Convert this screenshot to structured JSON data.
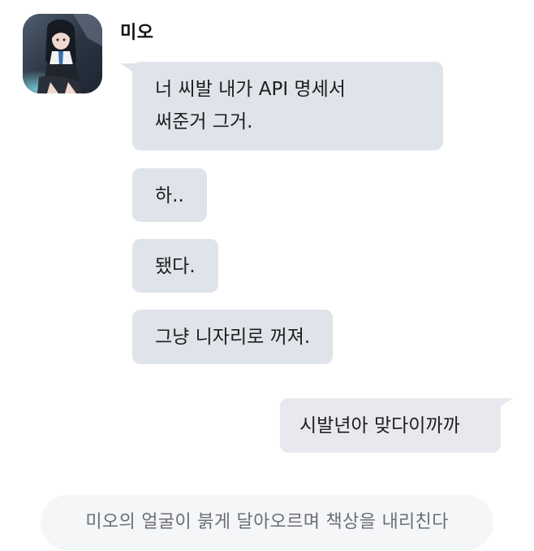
{
  "chat": {
    "sender_name": "미오",
    "messages_in": [
      "너 씨발 내가 API 명세서\n써준거 그거.",
      "하..",
      "됐다.",
      "그냥 니자리로 꺼져."
    ],
    "message_out": "시발년아 맞다이까까",
    "narration": "미오의 얼굴이 붉게 달아오르며 책상을 내리친다"
  },
  "colors": {
    "incoming_bubble": "#dfe3ea",
    "outgoing_bubble": "#e8e9ee",
    "narration_bg": "#f5f6f8",
    "narration_text": "#6b6e75"
  }
}
